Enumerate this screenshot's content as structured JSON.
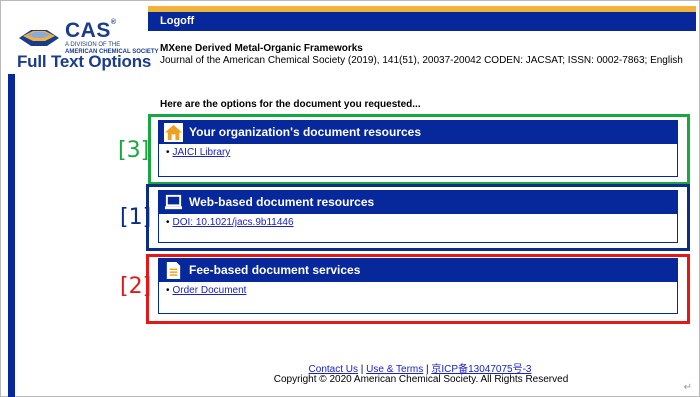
{
  "header": {
    "logoff_label": "Logoff",
    "accent_gold": "#f0b43a",
    "bar_blue": "#07289a"
  },
  "logo": {
    "name": "CAS",
    "registered": "®",
    "division_line1": "A DIVISION OF THE",
    "division_line2": "AMERICAN CHEMICAL SOCIETY"
  },
  "page_title": "Full Text Options",
  "document": {
    "title": "MXene Derived Metal-Organic Frameworks",
    "citation": "Journal of the American Chemical Society (2019), 141(51), 20037-20042 CODEN: JACSAT; ISSN: 0002-7863; English"
  },
  "intro": "Here are the options for the document you requested...",
  "sections": {
    "org": {
      "title": "Your organization's document resources",
      "icon": "home-icon",
      "link": "JAICI Library",
      "bracket": "[3]",
      "highlight_color": "#1aa640"
    },
    "web": {
      "title": "Web-based document resources",
      "icon": "laptop-icon",
      "link": "DOI: 10.1021/jacs.9b11446",
      "bracket": "[1]",
      "highlight_color": "#0a2d88"
    },
    "fee": {
      "title": "Fee-based document services",
      "icon": "document-icon",
      "link": "Order Document",
      "bracket": "[2]",
      "highlight_color": "#e01919"
    }
  },
  "bullet": "•",
  "footer": {
    "contact": "Contact Us",
    "separator": "|",
    "terms": "Use & Terms",
    "icp": "京ICP备13047075号-3",
    "copyright": "Copyright © 2020 American Chemical Society. All Rights Reserved"
  },
  "corner_mark": "↵"
}
